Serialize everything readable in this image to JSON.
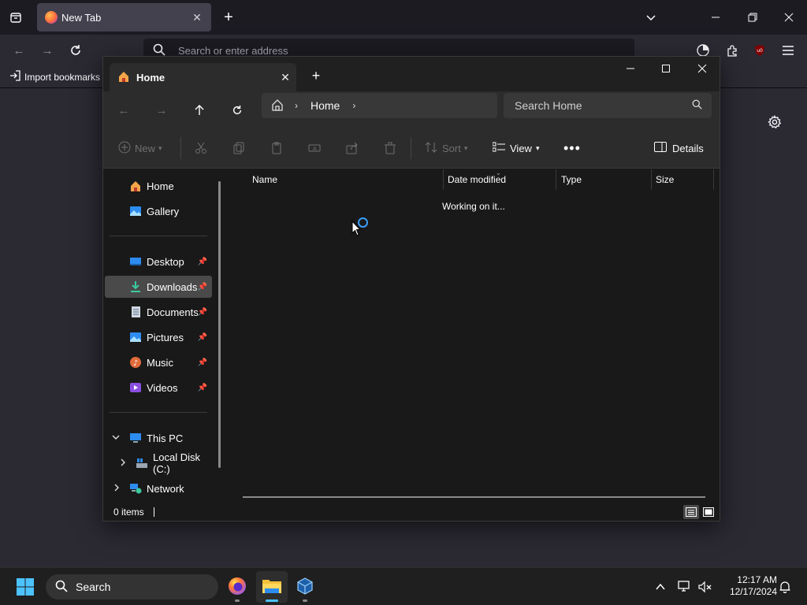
{
  "firefox": {
    "tab_title": "New Tab",
    "address_placeholder": "Search or enter address",
    "import_bookmarks": "Import bookmarks"
  },
  "explorer": {
    "tab_title": "Home",
    "breadcrumb": "Home",
    "search_placeholder": "Search Home",
    "toolbar": {
      "new_label": "New",
      "sort_label": "Sort",
      "view_label": "View",
      "details_label": "Details"
    },
    "nav": {
      "home": "Home",
      "gallery": "Gallery",
      "desktop": "Desktop",
      "downloads": "Downloads",
      "documents": "Documents",
      "pictures": "Pictures",
      "music": "Music",
      "videos": "Videos",
      "this_pc": "This PC",
      "local_disk": "Local Disk (C:)",
      "network": "Network"
    },
    "columns": {
      "name": "Name",
      "date_modified": "Date modified",
      "type": "Type",
      "size": "Size"
    },
    "working_text": "Working on it...",
    "status_count": "0 items"
  },
  "taskbar": {
    "search_label": "Search",
    "time": "12:17 AM",
    "date": "12/17/2024"
  },
  "colors": {
    "accent": "#3b9cf7",
    "firefox_dark": "#1c1b22",
    "explorer_bg": "#191919"
  }
}
